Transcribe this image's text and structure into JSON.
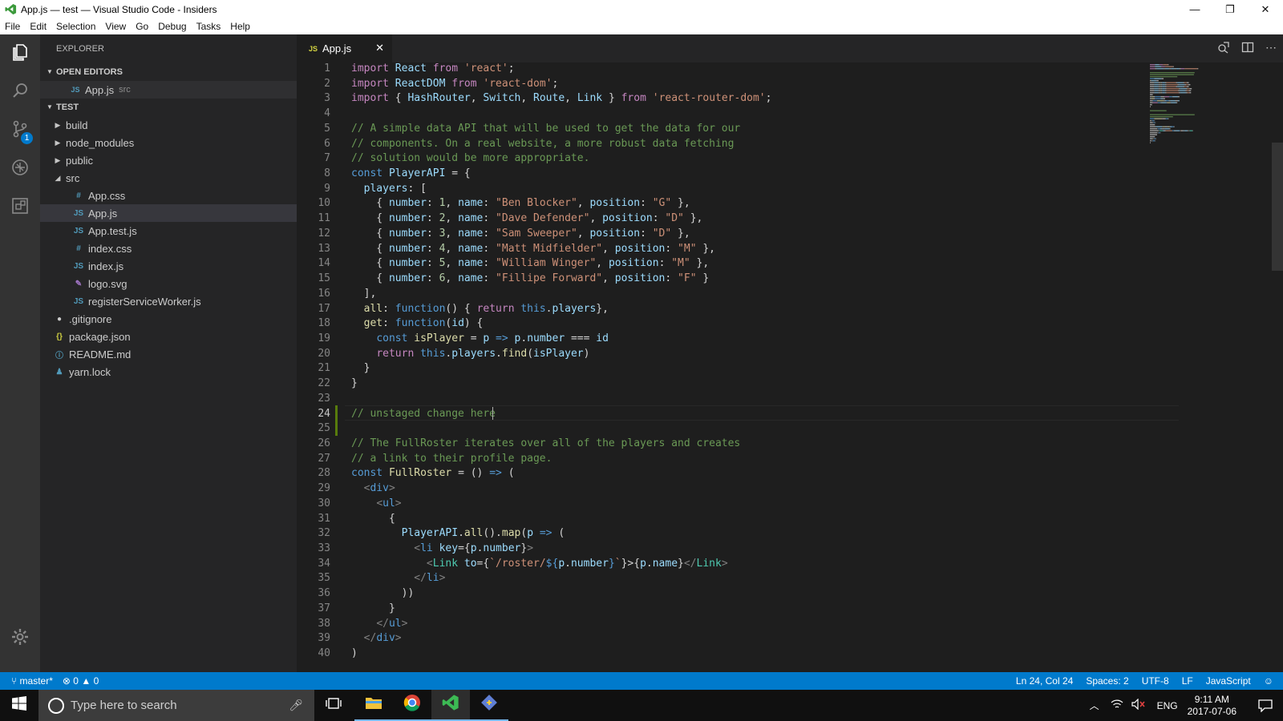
{
  "window": {
    "title": "App.js — test — Visual Studio Code - Insiders",
    "minimize": "—",
    "maximize": "❐",
    "close": "✕"
  },
  "menu": [
    "File",
    "Edit",
    "Selection",
    "View",
    "Go",
    "Debug",
    "Tasks",
    "Help"
  ],
  "activity": {
    "scm_badge": "1"
  },
  "explorer": {
    "title": "EXPLORER",
    "open_editors_label": "OPEN EDITORS",
    "open_editors": [
      {
        "icon": "JS",
        "name": "App.js",
        "desc": "src"
      }
    ],
    "folder_label": "TEST",
    "tree": [
      {
        "type": "folder",
        "name": "build",
        "expanded": false,
        "level": 1
      },
      {
        "type": "folder",
        "name": "node_modules",
        "expanded": false,
        "level": 1
      },
      {
        "type": "folder",
        "name": "public",
        "expanded": false,
        "level": 1
      },
      {
        "type": "folder",
        "name": "src",
        "expanded": true,
        "level": 1
      },
      {
        "type": "file",
        "icon": "#",
        "name": "App.css",
        "level": 2,
        "color": "#519aba"
      },
      {
        "type": "file",
        "icon": "JS",
        "name": "App.js",
        "level": 2,
        "color": "#519aba",
        "selected": true
      },
      {
        "type": "file",
        "icon": "JS",
        "name": "App.test.js",
        "level": 2,
        "color": "#519aba"
      },
      {
        "type": "file",
        "icon": "#",
        "name": "index.css",
        "level": 2,
        "color": "#519aba"
      },
      {
        "type": "file",
        "icon": "JS",
        "name": "index.js",
        "level": 2,
        "color": "#519aba"
      },
      {
        "type": "file",
        "icon": "✎",
        "name": "logo.svg",
        "level": 2,
        "color": "#a074c4"
      },
      {
        "type": "file",
        "icon": "JS",
        "name": "registerServiceWorker.js",
        "level": 2,
        "color": "#519aba"
      },
      {
        "type": "file",
        "icon": "●",
        "name": ".gitignore",
        "level": 1,
        "color": "#cccccc"
      },
      {
        "type": "file",
        "icon": "{}",
        "name": "package.json",
        "level": 1,
        "color": "#cbcb41"
      },
      {
        "type": "file",
        "icon": "ⓘ",
        "name": "README.md",
        "level": 1,
        "color": "#519aba"
      },
      {
        "type": "file",
        "icon": "♟",
        "name": "yarn.lock",
        "level": 1,
        "color": "#519aba"
      }
    ]
  },
  "tab": {
    "icon": "JS",
    "label": "App.js",
    "close": "✕"
  },
  "code": [
    [
      [
        "kw",
        "import "
      ],
      [
        "id",
        "React "
      ],
      [
        "kw",
        "from "
      ],
      [
        "str",
        "'react'"
      ],
      [
        "pl",
        ";"
      ]
    ],
    [
      [
        "kw",
        "import "
      ],
      [
        "id",
        "ReactDOM "
      ],
      [
        "kw",
        "from "
      ],
      [
        "str",
        "'react-dom'"
      ],
      [
        "pl",
        ";"
      ]
    ],
    [
      [
        "kw",
        "import "
      ],
      [
        "pl",
        "{ "
      ],
      [
        "id",
        "HashRouter"
      ],
      [
        "pl",
        ", "
      ],
      [
        "id",
        "Switch"
      ],
      [
        "pl",
        ", "
      ],
      [
        "id",
        "Route"
      ],
      [
        "pl",
        ", "
      ],
      [
        "id",
        "Link "
      ],
      [
        "pl",
        "} "
      ],
      [
        "kw",
        "from "
      ],
      [
        "str",
        "'react-router-dom'"
      ],
      [
        "pl",
        ";"
      ]
    ],
    [],
    [
      [
        "cm",
        "// A simple data API that will be used to get the data for our"
      ]
    ],
    [
      [
        "cm",
        "// components. On a real website, a more robust data fetching"
      ]
    ],
    [
      [
        "cm",
        "// solution would be more appropriate."
      ]
    ],
    [
      [
        "kb",
        "const "
      ],
      [
        "id",
        "PlayerAPI "
      ],
      [
        "pl",
        "= {"
      ]
    ],
    [
      [
        "pl",
        "  "
      ],
      [
        "id",
        "players"
      ],
      [
        "pl",
        ": ["
      ]
    ],
    [
      [
        "pl",
        "    { "
      ],
      [
        "id",
        "number"
      ],
      [
        "pl",
        ": "
      ],
      [
        "num",
        "1"
      ],
      [
        "pl",
        ", "
      ],
      [
        "id",
        "name"
      ],
      [
        "pl",
        ": "
      ],
      [
        "str",
        "\"Ben Blocker\""
      ],
      [
        "pl",
        ", "
      ],
      [
        "id",
        "position"
      ],
      [
        "pl",
        ": "
      ],
      [
        "str",
        "\"G\""
      ],
      [
        "pl",
        " },"
      ]
    ],
    [
      [
        "pl",
        "    { "
      ],
      [
        "id",
        "number"
      ],
      [
        "pl",
        ": "
      ],
      [
        "num",
        "2"
      ],
      [
        "pl",
        ", "
      ],
      [
        "id",
        "name"
      ],
      [
        "pl",
        ": "
      ],
      [
        "str",
        "\"Dave Defender\""
      ],
      [
        "pl",
        ", "
      ],
      [
        "id",
        "position"
      ],
      [
        "pl",
        ": "
      ],
      [
        "str",
        "\"D\""
      ],
      [
        "pl",
        " },"
      ]
    ],
    [
      [
        "pl",
        "    { "
      ],
      [
        "id",
        "number"
      ],
      [
        "pl",
        ": "
      ],
      [
        "num",
        "3"
      ],
      [
        "pl",
        ", "
      ],
      [
        "id",
        "name"
      ],
      [
        "pl",
        ": "
      ],
      [
        "str",
        "\"Sam Sweeper\""
      ],
      [
        "pl",
        ", "
      ],
      [
        "id",
        "position"
      ],
      [
        "pl",
        ": "
      ],
      [
        "str",
        "\"D\""
      ],
      [
        "pl",
        " },"
      ]
    ],
    [
      [
        "pl",
        "    { "
      ],
      [
        "id",
        "number"
      ],
      [
        "pl",
        ": "
      ],
      [
        "num",
        "4"
      ],
      [
        "pl",
        ", "
      ],
      [
        "id",
        "name"
      ],
      [
        "pl",
        ": "
      ],
      [
        "str",
        "\"Matt Midfielder\""
      ],
      [
        "pl",
        ", "
      ],
      [
        "id",
        "position"
      ],
      [
        "pl",
        ": "
      ],
      [
        "str",
        "\"M\""
      ],
      [
        "pl",
        " },"
      ]
    ],
    [
      [
        "pl",
        "    { "
      ],
      [
        "id",
        "number"
      ],
      [
        "pl",
        ": "
      ],
      [
        "num",
        "5"
      ],
      [
        "pl",
        ", "
      ],
      [
        "id",
        "name"
      ],
      [
        "pl",
        ": "
      ],
      [
        "str",
        "\"William Winger\""
      ],
      [
        "pl",
        ", "
      ],
      [
        "id",
        "position"
      ],
      [
        "pl",
        ": "
      ],
      [
        "str",
        "\"M\""
      ],
      [
        "pl",
        " },"
      ]
    ],
    [
      [
        "pl",
        "    { "
      ],
      [
        "id",
        "number"
      ],
      [
        "pl",
        ": "
      ],
      [
        "num",
        "6"
      ],
      [
        "pl",
        ", "
      ],
      [
        "id",
        "name"
      ],
      [
        "pl",
        ": "
      ],
      [
        "str",
        "\"Fillipe Forward\""
      ],
      [
        "pl",
        ", "
      ],
      [
        "id",
        "position"
      ],
      [
        "pl",
        ": "
      ],
      [
        "str",
        "\"F\""
      ],
      [
        "pl",
        " }"
      ]
    ],
    [
      [
        "pl",
        "  ],"
      ]
    ],
    [
      [
        "pl",
        "  "
      ],
      [
        "fn",
        "all"
      ],
      [
        "pl",
        ": "
      ],
      [
        "kb",
        "function"
      ],
      [
        "pl",
        "() { "
      ],
      [
        "kw",
        "return "
      ],
      [
        "kb",
        "this"
      ],
      [
        "pl",
        "."
      ],
      [
        "id",
        "players"
      ],
      [
        "pl",
        "},"
      ]
    ],
    [
      [
        "pl",
        "  "
      ],
      [
        "fn",
        "get"
      ],
      [
        "pl",
        ": "
      ],
      [
        "kb",
        "function"
      ],
      [
        "pl",
        "("
      ],
      [
        "id",
        "id"
      ],
      [
        "pl",
        ") {"
      ]
    ],
    [
      [
        "pl",
        "    "
      ],
      [
        "kb",
        "const "
      ],
      [
        "fn",
        "isPlayer "
      ],
      [
        "pl",
        "= "
      ],
      [
        "id",
        "p "
      ],
      [
        "kb",
        "=> "
      ],
      [
        "id",
        "p"
      ],
      [
        "pl",
        "."
      ],
      [
        "id",
        "number "
      ],
      [
        "pl",
        "=== "
      ],
      [
        "id",
        "id"
      ]
    ],
    [
      [
        "pl",
        "    "
      ],
      [
        "kw",
        "return "
      ],
      [
        "kb",
        "this"
      ],
      [
        "pl",
        "."
      ],
      [
        "id",
        "players"
      ],
      [
        "pl",
        "."
      ],
      [
        "fn",
        "find"
      ],
      [
        "pl",
        "("
      ],
      [
        "id",
        "isPlayer"
      ],
      [
        "pl",
        ")"
      ]
    ],
    [
      [
        "pl",
        "  }"
      ]
    ],
    [
      [
        "pl",
        "}"
      ]
    ],
    [],
    [
      [
        "cm",
        "// unstaged change here"
      ]
    ],
    [],
    [
      [
        "cm",
        "// The FullRoster iterates over all of the players and creates"
      ]
    ],
    [
      [
        "cm",
        "// a link to their profile page."
      ]
    ],
    [
      [
        "kb",
        "const "
      ],
      [
        "fn",
        "FullRoster "
      ],
      [
        "pl",
        "= () "
      ],
      [
        "kb",
        "=> "
      ],
      [
        "pl",
        "("
      ]
    ],
    [
      [
        "pl",
        "  "
      ],
      [
        "tg",
        "<"
      ],
      [
        "kb",
        "div"
      ],
      [
        "tg",
        ">"
      ]
    ],
    [
      [
        "pl",
        "    "
      ],
      [
        "tg",
        "<"
      ],
      [
        "kb",
        "ul"
      ],
      [
        "tg",
        ">"
      ]
    ],
    [
      [
        "pl",
        "      {"
      ]
    ],
    [
      [
        "pl",
        "        "
      ],
      [
        "id",
        "PlayerAPI"
      ],
      [
        "pl",
        "."
      ],
      [
        "fn",
        "all"
      ],
      [
        "pl",
        "()."
      ],
      [
        "fn",
        "map"
      ],
      [
        "pl",
        "("
      ],
      [
        "id",
        "p "
      ],
      [
        "kb",
        "=> "
      ],
      [
        "pl",
        "("
      ]
    ],
    [
      [
        "pl",
        "          "
      ],
      [
        "tg",
        "<"
      ],
      [
        "kb",
        "li "
      ],
      [
        "id",
        "key"
      ],
      [
        "pl",
        "={"
      ],
      [
        "id",
        "p"
      ],
      [
        "pl",
        "."
      ],
      [
        "id",
        "number"
      ],
      [
        "pl",
        "}"
      ],
      [
        "tg",
        ">"
      ]
    ],
    [
      [
        "pl",
        "            "
      ],
      [
        "tg",
        "<"
      ],
      [
        "cls",
        "Link "
      ],
      [
        "id",
        "to"
      ],
      [
        "pl",
        "={"
      ],
      [
        "str",
        "`/roster/"
      ],
      [
        "kb",
        "${"
      ],
      [
        "id",
        "p"
      ],
      [
        "pl",
        "."
      ],
      [
        "id",
        "number"
      ],
      [
        "kb",
        "}"
      ],
      [
        "str",
        "`"
      ],
      [
        "pl",
        "}>{"
      ],
      [
        "id",
        "p"
      ],
      [
        "pl",
        "."
      ],
      [
        "id",
        "name"
      ],
      [
        "pl",
        "}"
      ],
      [
        "tg",
        "</"
      ],
      [
        "cls",
        "Link"
      ],
      [
        "tg",
        ">"
      ]
    ],
    [
      [
        "pl",
        "          "
      ],
      [
        "tg",
        "</"
      ],
      [
        "kb",
        "li"
      ],
      [
        "tg",
        ">"
      ]
    ],
    [
      [
        "pl",
        "        ))"
      ]
    ],
    [
      [
        "pl",
        "      }"
      ]
    ],
    [
      [
        "pl",
        "    "
      ],
      [
        "tg",
        "</"
      ],
      [
        "kb",
        "ul"
      ],
      [
        "tg",
        ">"
      ]
    ],
    [
      [
        "pl",
        "  "
      ],
      [
        "tg",
        "</"
      ],
      [
        "kb",
        "div"
      ],
      [
        "tg",
        ">"
      ]
    ],
    [
      [
        "pl",
        ")"
      ]
    ]
  ],
  "status": {
    "branch": "master*",
    "errors": "0",
    "warnings": "0",
    "position": "Ln 24, Col 24",
    "spaces": "Spaces: 2",
    "encoding": "UTF-8",
    "eol": "LF",
    "language": "JavaScript"
  },
  "taskbar": {
    "search_placeholder": "Type here to search",
    "language": "ENG",
    "time": "9:11 AM",
    "date": "2017-07-06"
  }
}
